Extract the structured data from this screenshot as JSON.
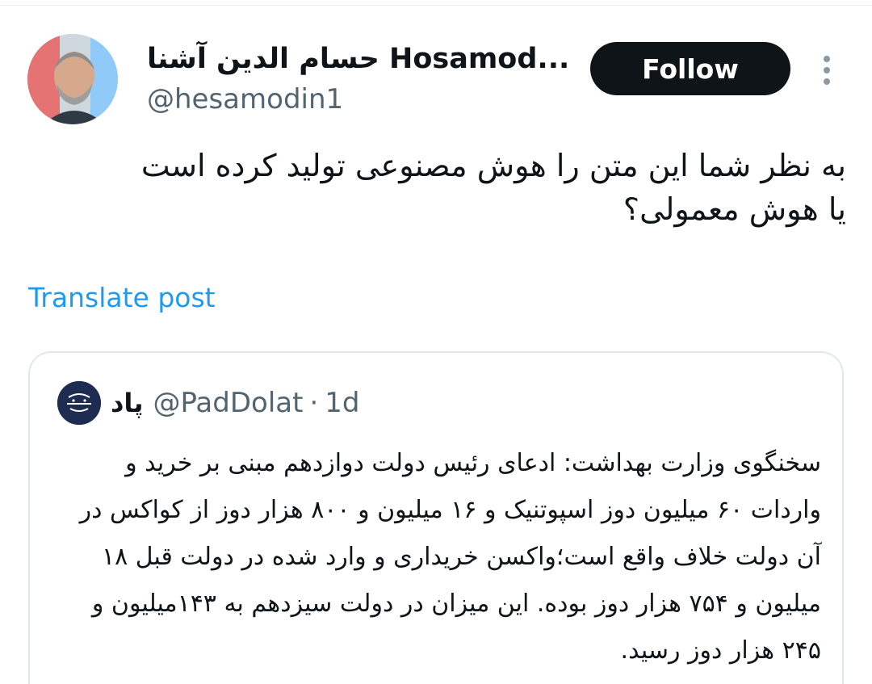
{
  "author": {
    "display_name": "حسام الدین آشنا Hosamod...",
    "handle": "@hesamodin1",
    "avatar_icon": "user-photo-avatar"
  },
  "actions": {
    "follow_label": "Follow",
    "more_icon": "more-vertical-icon"
  },
  "tweet": {
    "text_line1": "به نظر شما این متن را هوش مصنوعی تولید کرده است",
    "text_line2": "یا هوش معمولی؟",
    "translate_label": "Translate post"
  },
  "quote": {
    "name": "پاد",
    "handle": "@PadDolat",
    "separator": "·",
    "time": "1d",
    "avatar_icon": "paddolat-logo",
    "text": "سخنگوی وزارت بهداشت: ادعای رئیس دولت دوازدهم مبنی بر خرید و واردات ۶۰ میلیون دوز اسپوتنیک و ۱۶ میلیون و ۸۰۰ هزار دوز از کواکس در آن دولت خلاف واقع است؛واکسن خریداری و وارد شده در دولت قبل ۱۸ میلیون و ۷۵۴ هزار دوز بوده. این میزان در دولت سیزدهم به ۱۴۳میلیون و ۲۴۵ هزار دوز رسید."
  },
  "colors": {
    "text": "#0f1419",
    "secondary": "#536471",
    "link": "#1d9bf0",
    "follow_bg": "#0f1419",
    "border": "#e1e8ed"
  }
}
